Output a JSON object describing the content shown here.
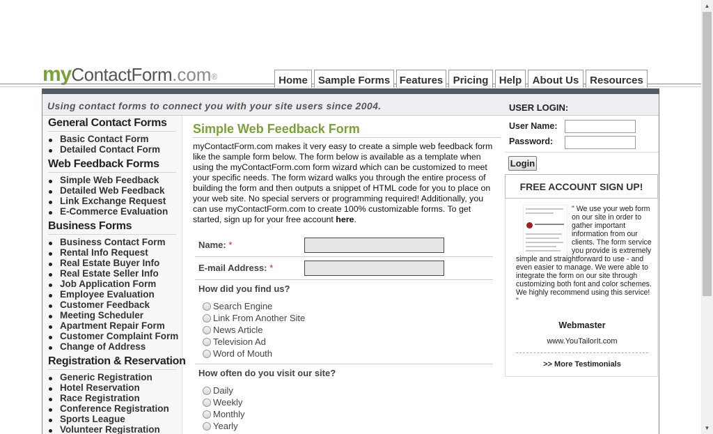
{
  "logo": {
    "my": "my",
    "contact_form": "ContactForm",
    "dot_com": ".com",
    "registered": "®"
  },
  "nav": {
    "tabs": [
      "Home",
      "Sample Forms",
      "Features",
      "Pricing",
      "Help",
      "About Us",
      "Resources"
    ]
  },
  "tagline": "Using contact forms to connect you with your site users since 2004.",
  "sidebar": {
    "sections": [
      {
        "heading": "General Contact Forms",
        "items": [
          "Basic Contact Form",
          "Detailed Contact Form"
        ]
      },
      {
        "heading": "Web Feedback Forms",
        "items": [
          "Simple Web Feedback",
          "Detailed Web Feedback",
          "Link Exchange Request",
          "E-Commerce Evaluation"
        ]
      },
      {
        "heading": "Business Forms",
        "items": [
          "Business Contact Form",
          "Rental Info Request",
          "Real Estate Buyer Info",
          "Real Estate Seller Info",
          "Job Application Form",
          "Employee Evaluation",
          "Customer Feedback",
          "Meeting Scheduler",
          "Apartment Repair Form",
          "Customer Complaint Form",
          "Change of Address"
        ]
      },
      {
        "heading": "Registration & Reservation",
        "items": [
          "Generic Registration",
          "Hotel Reservation",
          "Race Registration",
          "Conference Registration",
          "Sports League",
          "Volunteer Registration"
        ]
      }
    ]
  },
  "main": {
    "title": "Simple Web Feedback Form",
    "intro": "myContactForm.com makes it very easy to create a simple web feedback form like the sample form below. The form below is available as a template when using the myContactForm.com form wizard which can be customized to meet your specific needs. The form wizard walks you through the entire process of building the form and then outputs a snippet of HTML code for you to place on your web site. No special servers or programming required! Additionally, you can use myContactForm.com to create 100% customizable forms. To get started, sign up for your free account ",
    "intro_link": "here",
    "intro_end": "."
  },
  "form": {
    "name_label": "Name:",
    "email_label": "E-mail Address:",
    "required_mark": "*",
    "q1": "How did you find us?",
    "q1_options": [
      "Search Engine",
      "Link From Another Site",
      "News Article",
      "Television Ad",
      "Word of Mouth"
    ],
    "q2": "How often do you visit our site?",
    "q2_options": [
      "Daily",
      "Weekly",
      "Monthly",
      "Yearly"
    ]
  },
  "login": {
    "heading": "USER LOGIN:",
    "username_label": "User Name:",
    "password_label": "Password:",
    "button": "Login"
  },
  "signup": {
    "label": "FREE ACCOUNT SIGN UP!"
  },
  "testimonial": {
    "quote": "\" We use your web form on our site in order to gather important information from our clients. The form service you provide is extremely simple and straightforward to use - and even easier to manage. We were able to integrate the form on our site through customizing both font and color schemes. We highly recommend using this service! \"",
    "name": "Webmaster",
    "url": "www.YouTailorIt.com",
    "more": ">> More Testimonials",
    "thumb_text": "YouTailorIt.com"
  }
}
